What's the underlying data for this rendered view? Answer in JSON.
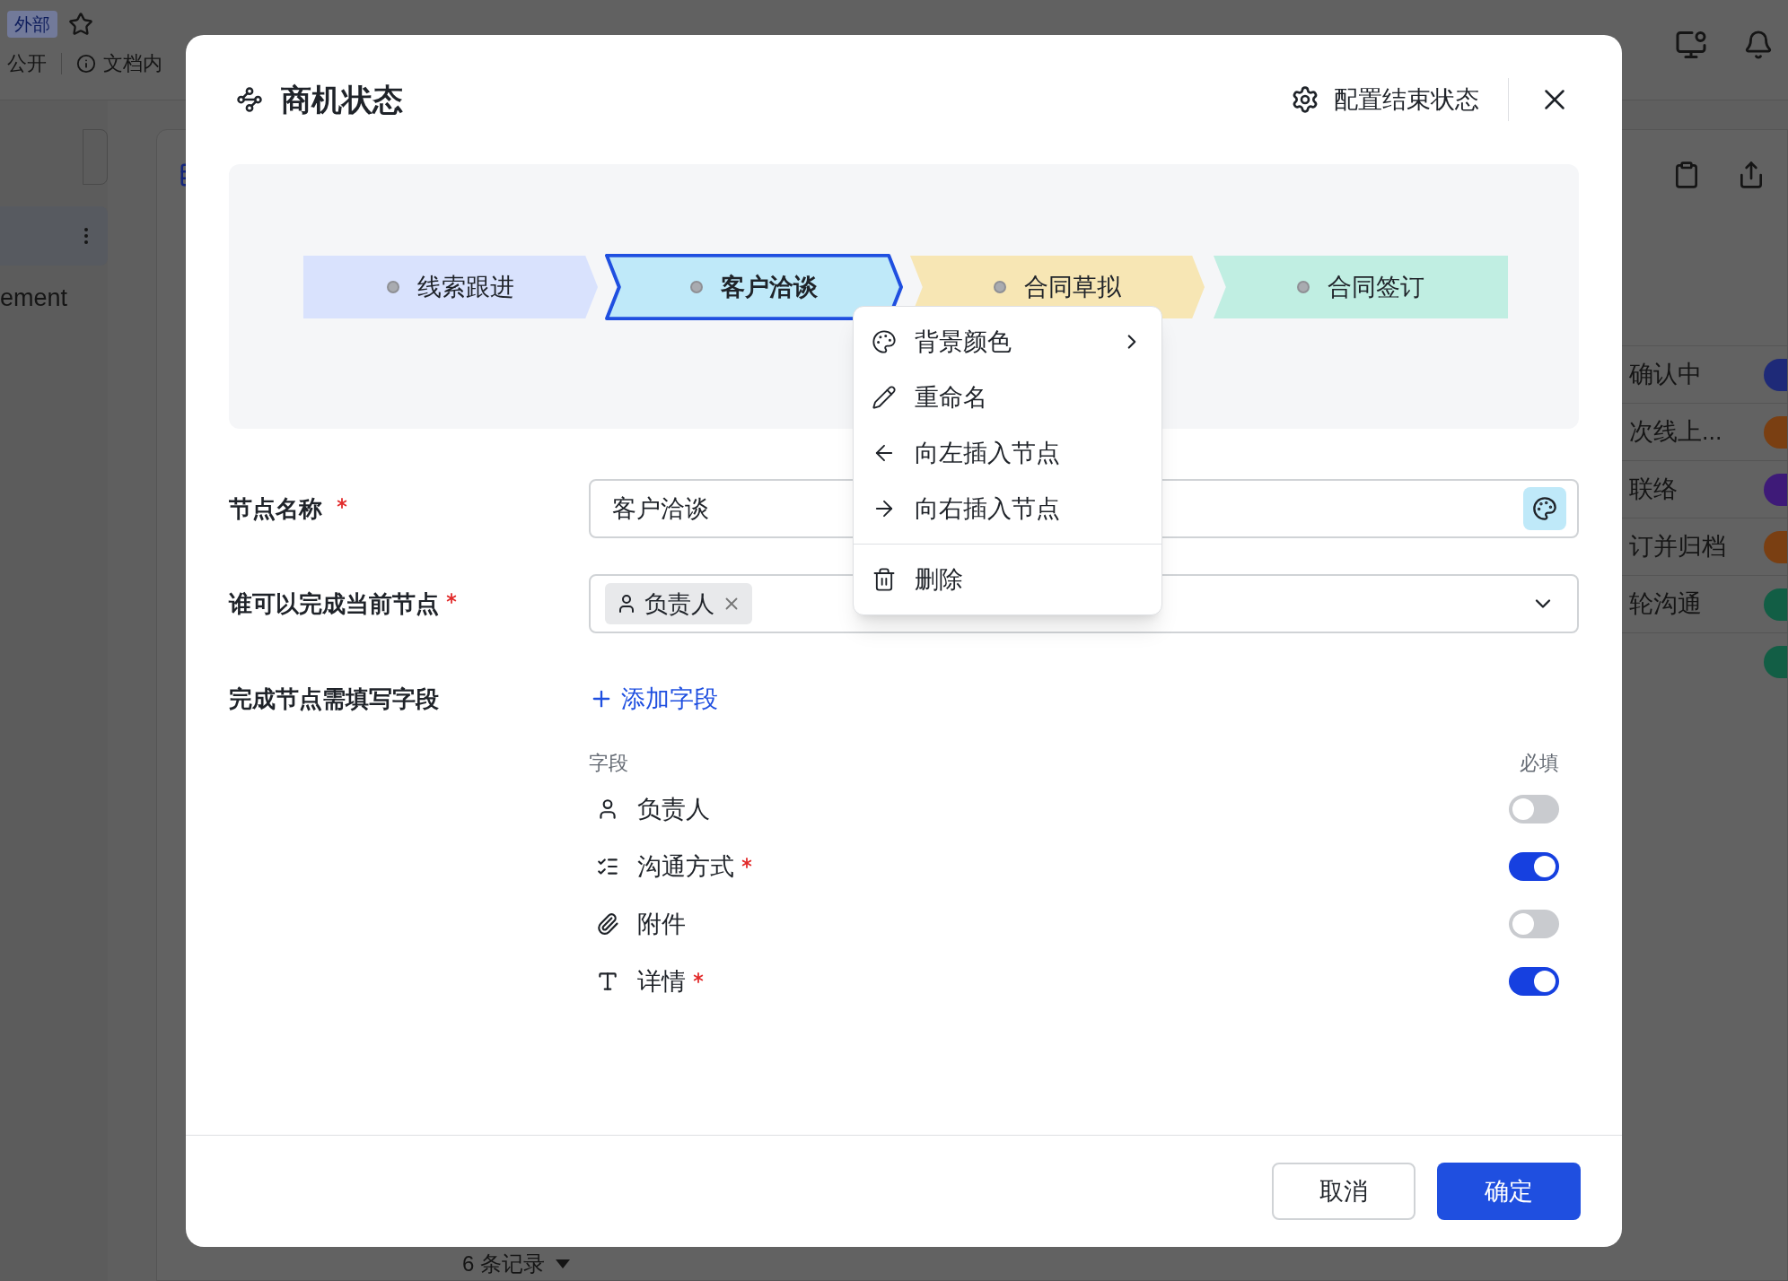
{
  "background": {
    "badge": "外部",
    "visibility": "公开",
    "doc_info": "文档内",
    "sidebar_text": "ement",
    "table_rows": [
      {
        "text": "确认中",
        "color": "#1e2a78"
      },
      {
        "text": "次线上...",
        "color": "#7a3f12"
      },
      {
        "text": "联络",
        "color": "#3e1a78"
      },
      {
        "text": "订并归档",
        "color": "#7a3f12"
      },
      {
        "text": "轮沟通",
        "color": "#125e45"
      },
      {
        "color": "#125e45"
      }
    ],
    "record_count": "6 条记录"
  },
  "dialog": {
    "title": "商机状态",
    "config_button": "配置结束状态",
    "stages": [
      {
        "label": "线索跟进",
        "color": "#d9e2fd",
        "selected": false
      },
      {
        "label": "客户洽谈",
        "color": "#bfe9f9",
        "selected": true
      },
      {
        "label": "合同草拟",
        "color": "#f7e6b4",
        "selected": false
      },
      {
        "label": "合同签订",
        "color": "#c0eee2",
        "selected": false
      }
    ],
    "context_menu": {
      "groups": [
        [
          {
            "label": "背景颜色",
            "kind": "submenu"
          },
          {
            "label": "重命名",
            "kind": "action"
          },
          {
            "label": "向左插入节点",
            "kind": "action"
          },
          {
            "label": "向右插入节点",
            "kind": "action"
          }
        ],
        [
          {
            "label": "删除",
            "kind": "action"
          }
        ]
      ]
    },
    "node_name": {
      "label": "节点名称",
      "required": true,
      "value": "客户洽谈"
    },
    "completer": {
      "label": "谁可以完成当前节点",
      "required": true,
      "tags": [
        "负责人"
      ]
    },
    "required_fields": {
      "label": "完成节点需填写字段",
      "add_link": "添加字段",
      "column_field": "字段",
      "column_required": "必填",
      "rows": [
        {
          "label": "负责人",
          "required": false,
          "on": false
        },
        {
          "label": "沟通方式",
          "required": true,
          "on": true
        },
        {
          "label": "附件",
          "required": false,
          "on": false
        },
        {
          "label": "详情",
          "required": true,
          "on": true
        }
      ]
    },
    "buttons": {
      "cancel": "取消",
      "ok": "确定"
    }
  }
}
